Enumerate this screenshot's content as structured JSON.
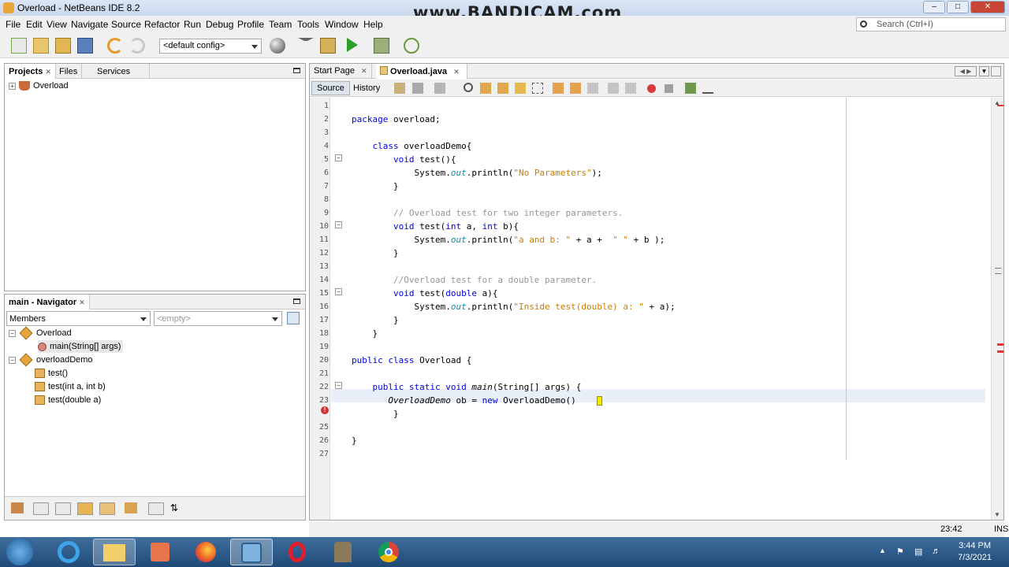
{
  "window": {
    "title": "Overload - NetBeans IDE 8.2",
    "watermark": "www.BANDICAM.com"
  },
  "menu": [
    "File",
    "Edit",
    "View",
    "Navigate",
    "Source",
    "Refactor",
    "Run",
    "Debug",
    "Profile",
    "Team",
    "Tools",
    "Window",
    "Help"
  ],
  "search": {
    "placeholder": "Search (Ctrl+I)"
  },
  "toolbar": {
    "config": "<default config>"
  },
  "projects": {
    "tabs": [
      "Projects",
      "Files",
      "Services"
    ],
    "tree": [
      {
        "label": "Overload"
      }
    ]
  },
  "navigator": {
    "title": "main - Navigator",
    "filter": "Members",
    "filter2": "<empty>",
    "tree": [
      "Overload",
      "main(String[] args)",
      "overloadDemo",
      "test()",
      "test(int a, int b)",
      "test(double a)"
    ]
  },
  "editor": {
    "tabs": [
      "Start Page",
      "Overload.java"
    ],
    "source_label": "Source",
    "history_label": "History",
    "lines": [
      {
        "n": "1",
        "html": ""
      },
      {
        "n": "2",
        "html": "<span class='kw'>package</span> overload;"
      },
      {
        "n": "3",
        "html": ""
      },
      {
        "n": "4",
        "html": "    <span class='kw'>class</span> overloadDemo{"
      },
      {
        "n": "5",
        "html": "        <span class='kw'>void</span> test(){"
      },
      {
        "n": "6",
        "html": "            System.<span class='stat'>out</span>.println(<span class='str'>\"No Parameters\"</span>);"
      },
      {
        "n": "7",
        "html": "        }"
      },
      {
        "n": "8",
        "html": ""
      },
      {
        "n": "9",
        "html": "        <span class='cmt'>// Overload test for two integer parameters.</span>"
      },
      {
        "n": "10",
        "html": "        <span class='kw'>void</span> test(<span class='kw'>int</span> a, <span class='kw'>int</span> b){"
      },
      {
        "n": "11",
        "html": "            System.<span class='stat'>out</span>.println(<span class='str'>\"a and b: \"</span> + a +  <span class='str'>\" \"</span> + b );"
      },
      {
        "n": "12",
        "html": "        }"
      },
      {
        "n": "13",
        "html": ""
      },
      {
        "n": "14",
        "html": "        <span class='cmt'>//Overload test for a double parameter.</span>"
      },
      {
        "n": "15",
        "html": "        <span class='kw'>void</span> test(<span class='kw'>double</span> a){"
      },
      {
        "n": "16",
        "html": "            System.<span class='stat'>out</span>.println(<span class='str'>\"Inside test(double) a: \"</span> + a);"
      },
      {
        "n": "17",
        "html": "        }"
      },
      {
        "n": "18",
        "html": "    }"
      },
      {
        "n": "19",
        "html": ""
      },
      {
        "n": "20",
        "html": "<span class='kw'>public class</span> Overload {"
      },
      {
        "n": "21",
        "html": ""
      },
      {
        "n": "22",
        "html": "    <span class='kw'>public static void</span> <span class='it'>main</span>(String[] args) {"
      },
      {
        "n": "23",
        "html": "       <span class='it'>OverloadDemo</span> ob = <span class='kw'>new</span> OverloadDemo()"
      },
      {
        "n": "",
        "html": "        }"
      },
      {
        "n": "25",
        "html": ""
      },
      {
        "n": "26",
        "html": "}"
      },
      {
        "n": "27",
        "html": ""
      }
    ]
  },
  "status": {
    "position": "23:42",
    "mode": "INS"
  },
  "clock": {
    "time": "3:44 PM",
    "date": "7/3/2021"
  }
}
